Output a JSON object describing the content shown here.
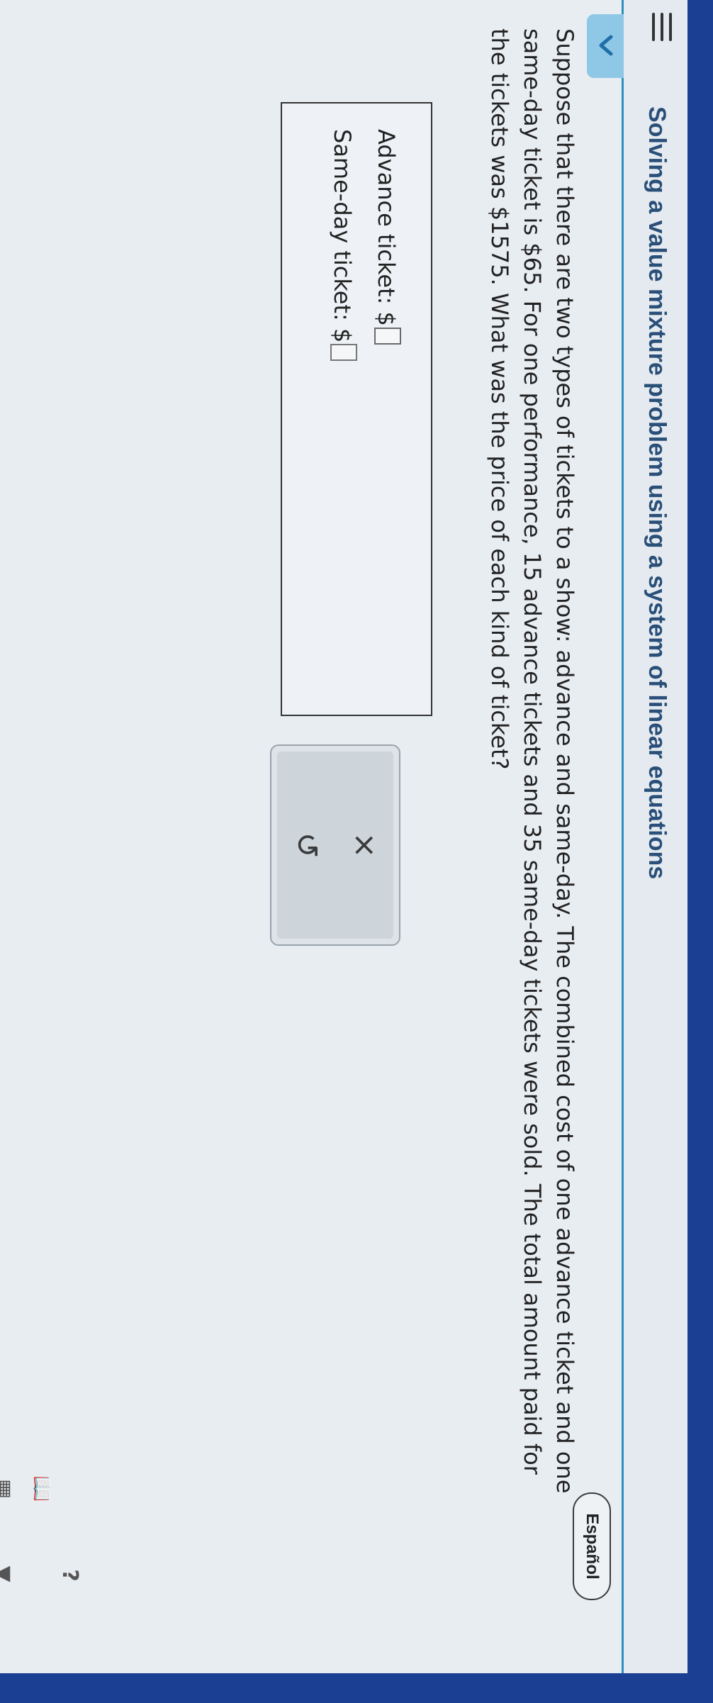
{
  "header": {
    "title": "Solving a value mixture problem using a system of linear equations",
    "language_button": "Español"
  },
  "question": {
    "text": "Suppose that there are two types of tickets to a show: advance and same-day. The combined cost of one advance ticket and one same-day ticket is $65. For one performance, 15 advance tickets and 35 same-day tickets were sold. The total amount paid for the tickets was $1575. What was the price of each kind of ticket?"
  },
  "answer": {
    "advance_label": "Advance ticket: $",
    "advance_value": "",
    "sameday_label": "Same-day ticket: $",
    "sameday_value": ""
  },
  "actions": {
    "clear_symbol": "×",
    "undo_symbol": "↺"
  },
  "toolbar": {
    "help_symbol": "?",
    "book_symbol": "📖",
    "calculator_symbol": "▦",
    "dropdown_symbol": "▼",
    "grid_symbol": "⊞"
  },
  "icons": [
    "menu-icon",
    "back-chevron-icon",
    "close-icon",
    "undo-icon",
    "help-icon",
    "book-icon",
    "calculator-icon",
    "dropdown-icon",
    "grid-icon"
  ],
  "colors": {
    "accent": "#2f8fc1",
    "title": "#2a4f78",
    "back_tab": "#8fc8e6",
    "background": "#e8edf2",
    "frame": "#1b3f93"
  }
}
